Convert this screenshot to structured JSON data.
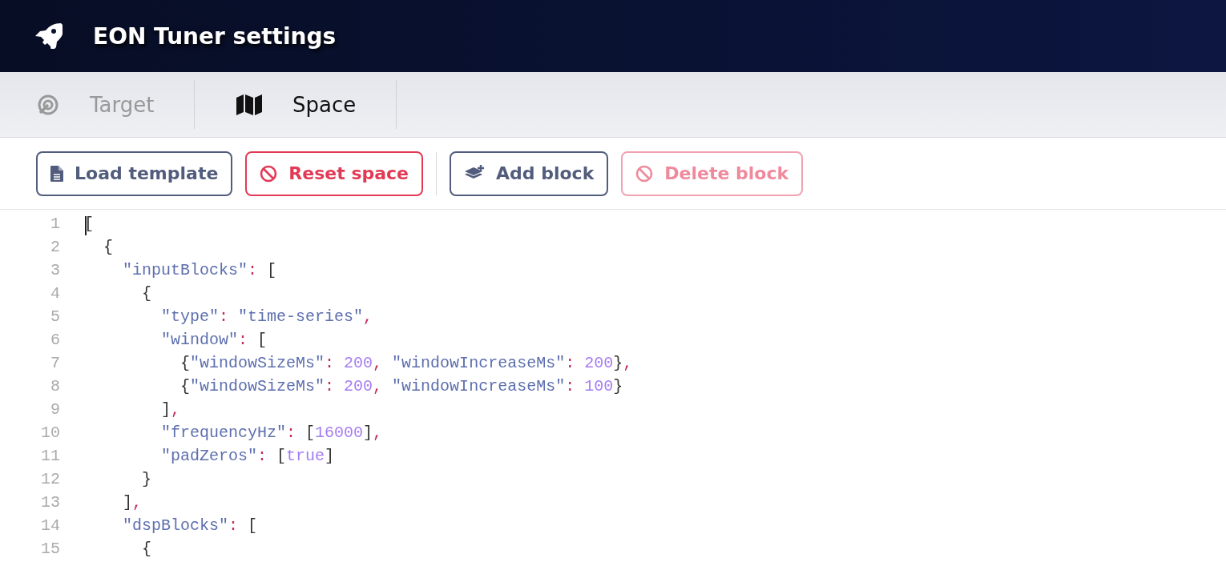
{
  "header": {
    "title": "EON Tuner settings"
  },
  "tabs": [
    {
      "label": "Target",
      "kind": "target",
      "selected": false
    },
    {
      "label": "Space",
      "kind": "map",
      "selected": true
    }
  ],
  "toolbar": {
    "groups": [
      [
        {
          "label": "Load template",
          "kind": "document",
          "disabled": false
        },
        {
          "label": "Reset space",
          "kind": "reset",
          "disabled": false
        }
      ],
      [
        {
          "label": "Add block",
          "kind": "add",
          "disabled": false
        },
        {
          "label": "Delete block",
          "kind": "delete",
          "disabled": true
        }
      ]
    ]
  },
  "editor": {
    "lines": [
      {
        "number": "1",
        "cursor": true,
        "tokens": [
          {
            "kind": "bracket",
            "text": "["
          }
        ]
      },
      {
        "number": "2",
        "cursor": false,
        "tokens": [
          {
            "kind": "bracket",
            "text": "  {"
          }
        ]
      },
      {
        "number": "3",
        "cursor": false,
        "tokens": [
          {
            "kind": "string",
            "text": "    \"inputBlocks\""
          },
          {
            "kind": "punct",
            "text": ": "
          },
          {
            "kind": "bracket",
            "text": "["
          }
        ]
      },
      {
        "number": "4",
        "cursor": false,
        "tokens": [
          {
            "kind": "bracket",
            "text": "      {"
          }
        ]
      },
      {
        "number": "5",
        "cursor": false,
        "tokens": [
          {
            "kind": "string",
            "text": "        \"type\""
          },
          {
            "kind": "punct",
            "text": ": "
          },
          {
            "kind": "string",
            "text": "\"time-series\""
          },
          {
            "kind": "punct",
            "text": ","
          }
        ]
      },
      {
        "number": "6",
        "cursor": false,
        "tokens": [
          {
            "kind": "string",
            "text": "        \"window\""
          },
          {
            "kind": "punct",
            "text": ": "
          },
          {
            "kind": "bracket",
            "text": "["
          }
        ]
      },
      {
        "number": "7",
        "cursor": false,
        "tokens": [
          {
            "kind": "bracket",
            "text": "          {"
          },
          {
            "kind": "string",
            "text": "\"windowSizeMs\""
          },
          {
            "kind": "punct",
            "text": ": "
          },
          {
            "kind": "number",
            "text": "200"
          },
          {
            "kind": "punct",
            "text": ", "
          },
          {
            "kind": "string",
            "text": "\"windowIncreaseMs\""
          },
          {
            "kind": "punct",
            "text": ": "
          },
          {
            "kind": "number",
            "text": "200"
          },
          {
            "kind": "bracket",
            "text": "}"
          },
          {
            "kind": "punct",
            "text": ","
          }
        ]
      },
      {
        "number": "8",
        "cursor": false,
        "tokens": [
          {
            "kind": "bracket",
            "text": "          {"
          },
          {
            "kind": "string",
            "text": "\"windowSizeMs\""
          },
          {
            "kind": "punct",
            "text": ": "
          },
          {
            "kind": "number",
            "text": "200"
          },
          {
            "kind": "punct",
            "text": ", "
          },
          {
            "kind": "string",
            "text": "\"windowIncreaseMs\""
          },
          {
            "kind": "punct",
            "text": ": "
          },
          {
            "kind": "number",
            "text": "100"
          },
          {
            "kind": "bracket",
            "text": "}"
          }
        ]
      },
      {
        "number": "9",
        "cursor": false,
        "tokens": [
          {
            "kind": "bracket",
            "text": "        ]"
          },
          {
            "kind": "punct",
            "text": ","
          }
        ]
      },
      {
        "number": "10",
        "cursor": false,
        "tokens": [
          {
            "kind": "string",
            "text": "        \"frequencyHz\""
          },
          {
            "kind": "punct",
            "text": ": "
          },
          {
            "kind": "bracket",
            "text": "["
          },
          {
            "kind": "number",
            "text": "16000"
          },
          {
            "kind": "bracket",
            "text": "]"
          },
          {
            "kind": "punct",
            "text": ","
          }
        ]
      },
      {
        "number": "11",
        "cursor": false,
        "tokens": [
          {
            "kind": "string",
            "text": "        \"padZeros\""
          },
          {
            "kind": "punct",
            "text": ": "
          },
          {
            "kind": "bracket",
            "text": "["
          },
          {
            "kind": "number",
            "text": "true"
          },
          {
            "kind": "bracket",
            "text": "]"
          }
        ]
      },
      {
        "number": "12",
        "cursor": false,
        "tokens": [
          {
            "kind": "bracket",
            "text": "      }"
          }
        ]
      },
      {
        "number": "13",
        "cursor": false,
        "tokens": [
          {
            "kind": "bracket",
            "text": "    ]"
          },
          {
            "kind": "punct",
            "text": ","
          }
        ]
      },
      {
        "number": "14",
        "cursor": false,
        "tokens": [
          {
            "kind": "string",
            "text": "    \"dspBlocks\""
          },
          {
            "kind": "punct",
            "text": ": "
          },
          {
            "kind": "bracket",
            "text": "["
          }
        ]
      },
      {
        "number": "15",
        "cursor": false,
        "tokens": [
          {
            "kind": "bracket",
            "text": "      {"
          }
        ]
      }
    ]
  }
}
